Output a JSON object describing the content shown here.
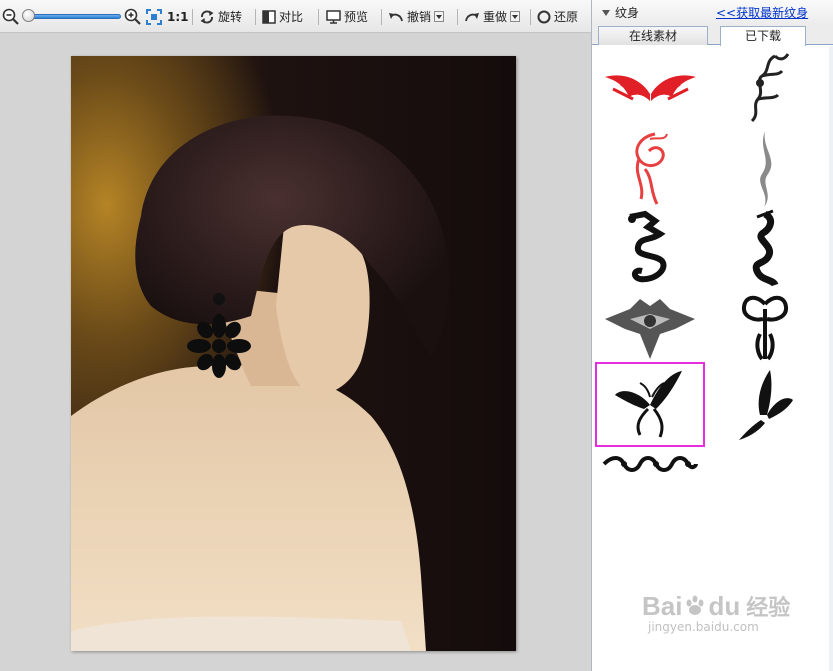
{
  "toolbar": {
    "fit_label": "1:1",
    "rotate_label": "旋转",
    "compare_label": "对比",
    "preview_label": "预览",
    "undo_label": "撤销",
    "redo_label": "重做",
    "restore_label": "还原"
  },
  "panel": {
    "title": "纹身",
    "get_more_link": "<<获取最新纹身",
    "tabs": [
      {
        "label": "在线素材",
        "active": false
      },
      {
        "label": "已下载",
        "active": true
      }
    ],
    "tattoos": [
      {
        "name": "red-wings",
        "color": "#e01f26"
      },
      {
        "name": "dragon-vertical",
        "color": "#222222"
      },
      {
        "name": "red-phoenix",
        "color": "#e84040"
      },
      {
        "name": "gray-tribal",
        "color": "#8a8a8a"
      },
      {
        "name": "black-dragon",
        "color": "#111111"
      },
      {
        "name": "black-dragon-2",
        "color": "#111111"
      },
      {
        "name": "gray-crest",
        "color": "#555555"
      },
      {
        "name": "tribal-butterfly",
        "color": "#111111"
      },
      {
        "name": "butterfly-selected",
        "color": "#111111",
        "selected": true
      },
      {
        "name": "butterfly-side",
        "color": "#111111"
      },
      {
        "name": "tribal-band",
        "color": "#111111"
      }
    ]
  },
  "watermark": {
    "brand": "Bai",
    "brand_tail": "du",
    "product": "经验",
    "url": "jingyen.baidu.com"
  },
  "colors": {
    "accent": "#2d7fd4",
    "selection": "#e52ee0",
    "link": "#0033cc"
  }
}
